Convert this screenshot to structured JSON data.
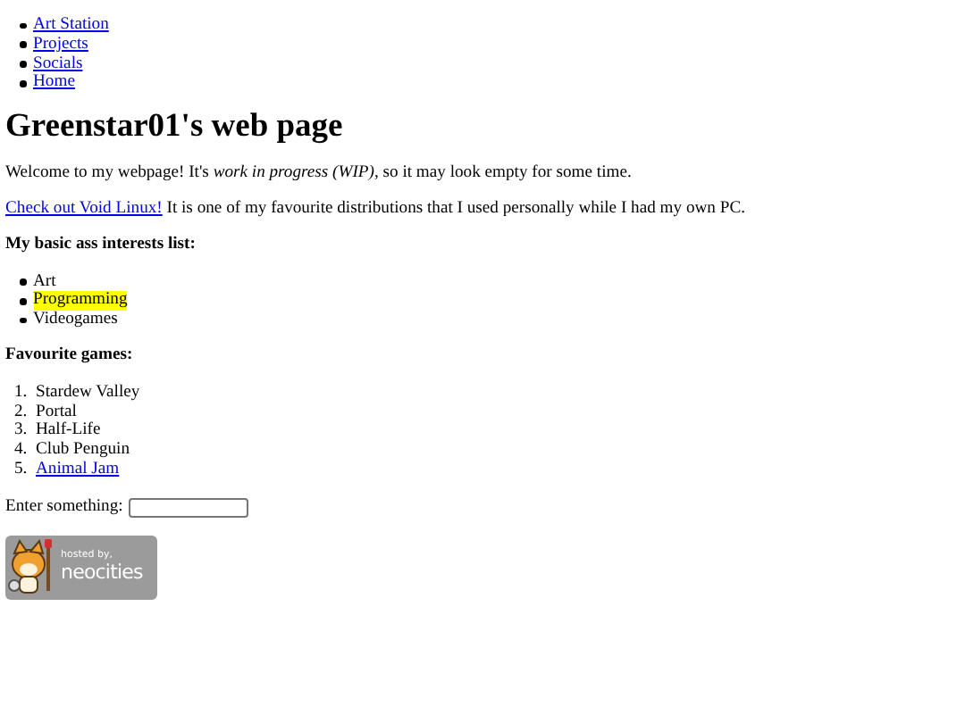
{
  "nav": [
    {
      "label": "Art Station"
    },
    {
      "label": "Projects"
    },
    {
      "label": "Socials"
    },
    {
      "label": "Home"
    }
  ],
  "title": "Greenstar01's web page",
  "intro": "Welcome to my webpage! It's *work in progress (WIP)*, so it may look empty for some time.",
  "linux": {
    "link": "Check out Void Linux!",
    "text": "It is one of my favourite distributions that I used personally while I had my own PC."
  },
  "interests": {
    "heading": "My basic ass interests list:",
    "items": [
      {
        "label": "Art",
        "highlighted": false
      },
      {
        "label": "Programming",
        "highlighted": true
      },
      {
        "label": "Videogames",
        "highlighted": false
      }
    ]
  },
  "games": {
    "heading": "Favourite games:",
    "items": [
      {
        "marker": "1.",
        "label": "Stardew Valley",
        "kind": "text"
      },
      {
        "marker": "2.",
        "label": "Portal",
        "kind": "text"
      },
      {
        "marker": "3.",
        "label": "Half-Life",
        "kind": "text"
      },
      {
        "marker": "4.",
        "label": "Club Penguin",
        "kind": "text"
      },
      {
        "marker": "5.",
        "label": "Animal Jam",
        "kind": "link"
      }
    ]
  },
  "input": {
    "label": "Enter something:"
  },
  "badge": {
    "small": "hosted by,",
    "big": "neocities"
  }
}
